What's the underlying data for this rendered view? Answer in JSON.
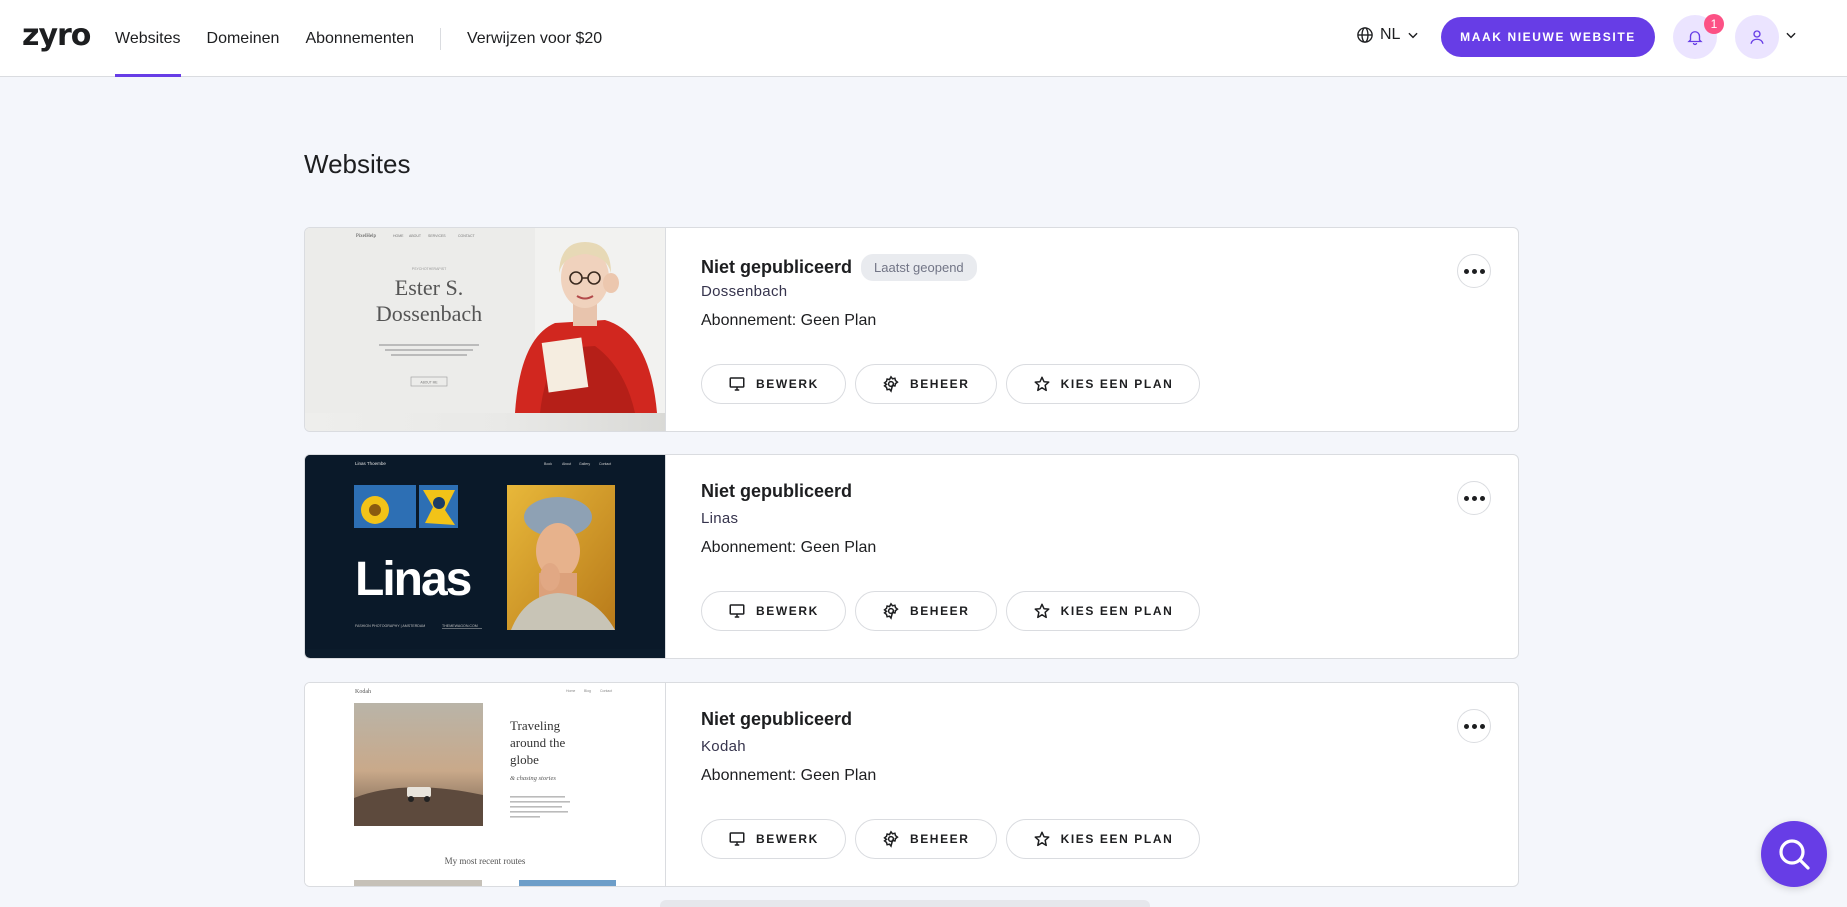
{
  "header": {
    "logo": "zyro",
    "nav": [
      {
        "label": "Websites",
        "active": true
      },
      {
        "label": "Domeinen",
        "active": false
      },
      {
        "label": "Abonnementen",
        "active": false
      }
    ],
    "referral": "Verwijzen voor $20",
    "language": "NL",
    "cta": "MAAK NIEUWE WEBSITE",
    "notification_count": "1",
    "accent_color": "#673de6"
  },
  "page_title": "Websites",
  "sites": [
    {
      "status": "Niet gepubliceerd",
      "badge": "Laatst geopend",
      "name": "Dossenbach",
      "plan": "Abonnement: Geen Plan",
      "buttons": {
        "edit": "BEWERK",
        "manage": "BEHEER",
        "plan": "KIES EEN PLAN"
      },
      "thumb": {
        "brand": "PixelHelp",
        "menu": [
          "HOME",
          "ABOUT",
          "SERVICES",
          "CONTACT"
        ],
        "pretitle": "PSYCHOTHERAPIST",
        "title1": "Ester S.",
        "title2": "Dossenbach",
        "button": "ABOUT ME"
      }
    },
    {
      "status": "Niet gepubliceerd",
      "badge": "",
      "name": "Linas",
      "plan": "Abonnement: Geen Plan",
      "buttons": {
        "edit": "BEWERK",
        "manage": "BEHEER",
        "plan": "KIES EEN PLAN"
      },
      "thumb": {
        "brand": "Linas Thoembe",
        "menu": [
          "Book",
          "About",
          "Gallery",
          "Contact"
        ],
        "title": "Linas",
        "footer_left": "FASHION PHOTOGRAPHY | AMSTERDAM",
        "footer_right": "THEMEWAGON.COM"
      }
    },
    {
      "status": "Niet gepubliceerd",
      "badge": "",
      "name": "Kodah",
      "plan": "Abonnement: Geen Plan",
      "buttons": {
        "edit": "BEWERK",
        "manage": "BEHEER",
        "plan": "KIES EEN PLAN"
      },
      "thumb": {
        "brand": "Kodah",
        "menu": [
          "Home",
          "Blog",
          "Contact"
        ],
        "headline1": "Traveling",
        "headline2": "around the",
        "headline3": "globe",
        "sub": "& chasing stories",
        "footer": "My most recent routes"
      }
    }
  ]
}
